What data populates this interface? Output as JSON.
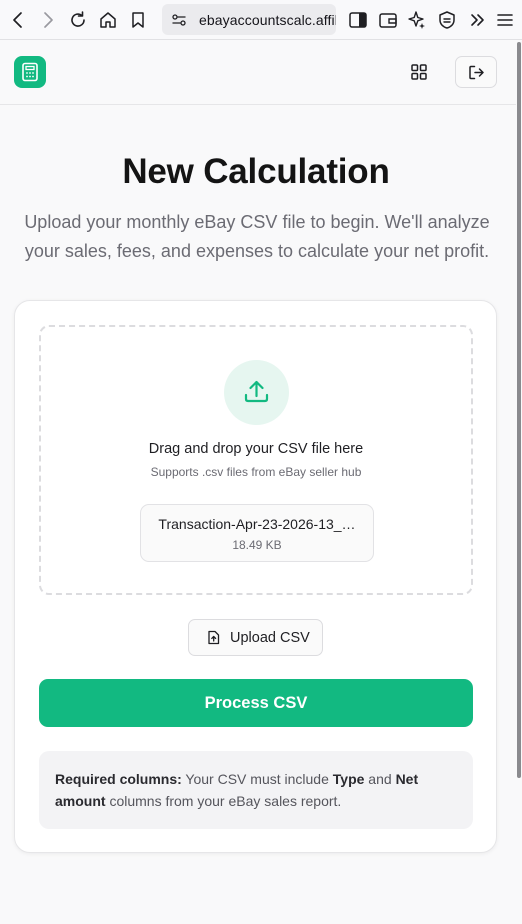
{
  "browser": {
    "url": "ebayaccountscalc.affili",
    "icons": [
      "back-icon",
      "forward-icon",
      "reload-icon",
      "home-icon",
      "bookmark-icon",
      "site-info-icon",
      "sidebar-icon",
      "wallet-icon",
      "sparkle-icon",
      "shield-icon",
      "chevron-double-right-icon",
      "menu-icon"
    ]
  },
  "header": {
    "logo_icon": "calculator-icon",
    "grid_icon": "grid-icon",
    "logout_icon": "logout-icon"
  },
  "main": {
    "title": "New Calculation",
    "subtitle": "Upload your monthly eBay CSV file to begin. We'll analyze your sales, fees, and expenses to calculate your net profit."
  },
  "upload": {
    "dropzone_title": "Drag and drop your CSV file here",
    "dropzone_subtitle": "Supports .csv files from eBay seller hub",
    "file_name": "Transaction-Apr-23-2026-13_…",
    "file_size": "18.49 KB",
    "upload_button_label": "Upload CSV",
    "process_button_label": "Process CSV"
  },
  "note": {
    "label": "Required columns:",
    "text_1": " Your CSV must include ",
    "col_1": "Type",
    "text_2": " and ",
    "col_2": "Net amount",
    "text_3": " columns from your eBay sales report."
  },
  "colors": {
    "accent": "#12b981",
    "accent_light": "#e6f6f0"
  }
}
